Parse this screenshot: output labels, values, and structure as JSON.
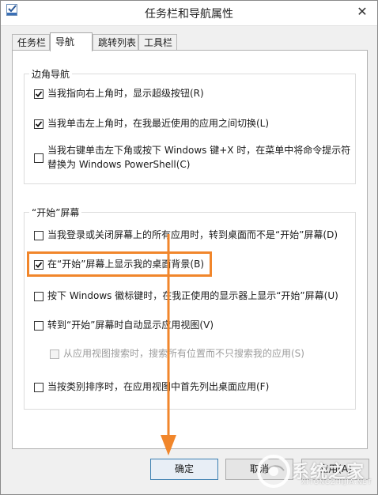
{
  "window": {
    "title": "任务栏和导航属性",
    "close_glyph": "✕"
  },
  "tabs": [
    {
      "label": "任务栏",
      "active": false
    },
    {
      "label": "导航",
      "active": true
    },
    {
      "label": "跳转列表",
      "active": false
    },
    {
      "label": "工具栏",
      "active": false
    }
  ],
  "corner_nav": {
    "legend": "边角导航",
    "options": [
      {
        "lines": [
          "当我指向右上角时，显示超级按钮(R)"
        ],
        "checked": true
      },
      {
        "lines": [
          "当我单击左上角时，在我最近使用的应用之间切换(L)"
        ],
        "checked": true
      },
      {
        "lines": [
          "当我右键单击左下角或按下 Windows 键+X 时，在菜单中将命令提示符",
          "替换为 Windows PowerShell(C)"
        ],
        "checked": false
      }
    ]
  },
  "start_screen": {
    "legend": "“开始”屏幕",
    "options": [
      {
        "lines": [
          "当我登录或关闭屏幕上的所有应用时，转到桌面而不是“开始”屏幕(D)"
        ],
        "checked": false,
        "disabled": false
      },
      {
        "lines": [
          "在“开始”屏幕上显示我的桌面背景(B)"
        ],
        "checked": true,
        "disabled": false
      },
      {
        "lines": [
          "按下 Windows 徽标键时，在我正使用的显示器上显示“开始”屏幕(U)"
        ],
        "checked": false,
        "disabled": false
      },
      {
        "lines": [
          "转到“开始”屏幕时自动显示应用视图(V)"
        ],
        "checked": false,
        "disabled": false
      },
      {
        "lines": [
          "从应用视图搜索时，搜索所有位置而不只搜索我的应用(S)"
        ],
        "checked": false,
        "disabled": true
      },
      {
        "lines": [
          "当按类别排序时，在应用视图中首先列出桌面应用(F)"
        ],
        "checked": false,
        "disabled": false
      }
    ]
  },
  "buttons": {
    "ok": "确定",
    "cancel": "取消",
    "apply": "应用(A)"
  },
  "watermark": {
    "text": "系统之家",
    "sub": "XITONGZHIJIA.NET"
  },
  "colors": {
    "highlight": "#f1862b",
    "arrow": "#f1862b"
  }
}
